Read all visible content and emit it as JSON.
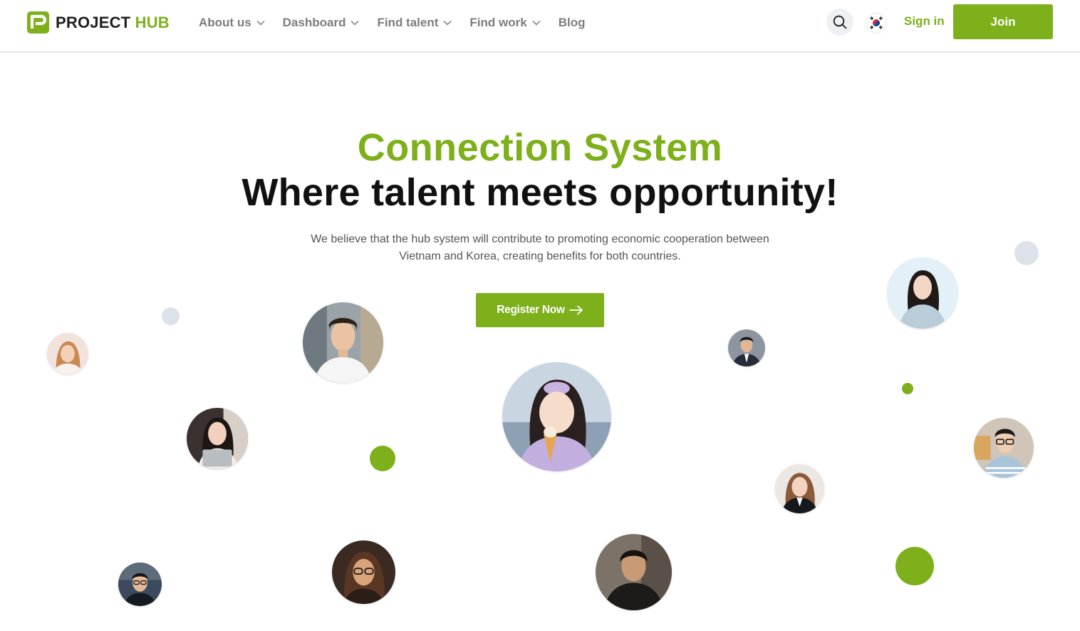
{
  "brand": {
    "name_part1": "PROJECT",
    "name_part2": "HUB",
    "accent_color": "#7db01b"
  },
  "nav": {
    "items": [
      {
        "label": "About us",
        "has_dropdown": true
      },
      {
        "label": "Dashboard",
        "has_dropdown": true
      },
      {
        "label": "Find talent",
        "has_dropdown": true
      },
      {
        "label": "Find work",
        "has_dropdown": true
      },
      {
        "label": "Blog",
        "has_dropdown": false
      }
    ]
  },
  "header": {
    "search_icon": "search-icon",
    "language_icon": "korea-flag-icon",
    "signin_label": "Sign in",
    "join_label": "Join"
  },
  "hero": {
    "title_line1": "Connection System",
    "title_line2": "Where talent meets opportunity!",
    "description": "We believe that the hub system will contribute to promoting economic cooperation between Vietnam and Korea, creating benefits for both countries.",
    "cta_label": "Register Now",
    "cta_icon": "arrow-right-icon"
  }
}
